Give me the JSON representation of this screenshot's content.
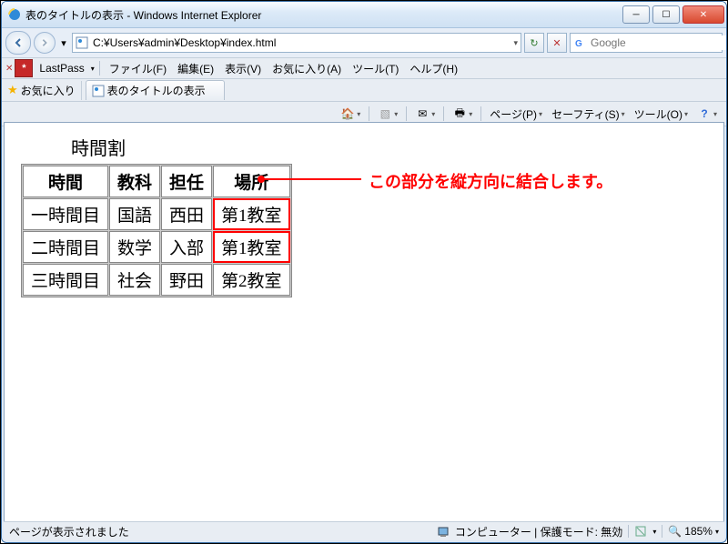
{
  "window": {
    "title": "表のタイトルの表示 - Windows Internet Explorer"
  },
  "address": {
    "path": "C:¥Users¥admin¥Desktop¥index.html",
    "search_placeholder": "Google"
  },
  "menus": {
    "lastpass": "LastPass",
    "file": "ファイル(F)",
    "edit": "編集(E)",
    "view": "表示(V)",
    "favs": "お気に入り(A)",
    "tools": "ツール(T)",
    "help": "ヘルプ(H)"
  },
  "favbar": {
    "fav": "お気に入り",
    "tab_title": "表のタイトルの表示"
  },
  "cmd": {
    "page": "ページ(P)",
    "safety": "セーフティ(S)",
    "tool": "ツール(O)"
  },
  "page": {
    "caption": "時間割",
    "headers": {
      "h1": "時間",
      "h2": "教科",
      "h3": "担任",
      "h4": "場所"
    },
    "rows": [
      {
        "period": "一時間目",
        "subject": "国語",
        "teacher": "西田",
        "room": "第1教室"
      },
      {
        "period": "二時間目",
        "subject": "数学",
        "teacher": "入部",
        "room": "第1教室"
      },
      {
        "period": "三時間目",
        "subject": "社会",
        "teacher": "野田",
        "room": "第2教室"
      }
    ]
  },
  "annotation": {
    "text": "この部分を縦方向に結合します。"
  },
  "status": {
    "left": "ページが表示されました",
    "zone": "コンピューター | 保護モード: 無効",
    "zoom": "185%"
  }
}
